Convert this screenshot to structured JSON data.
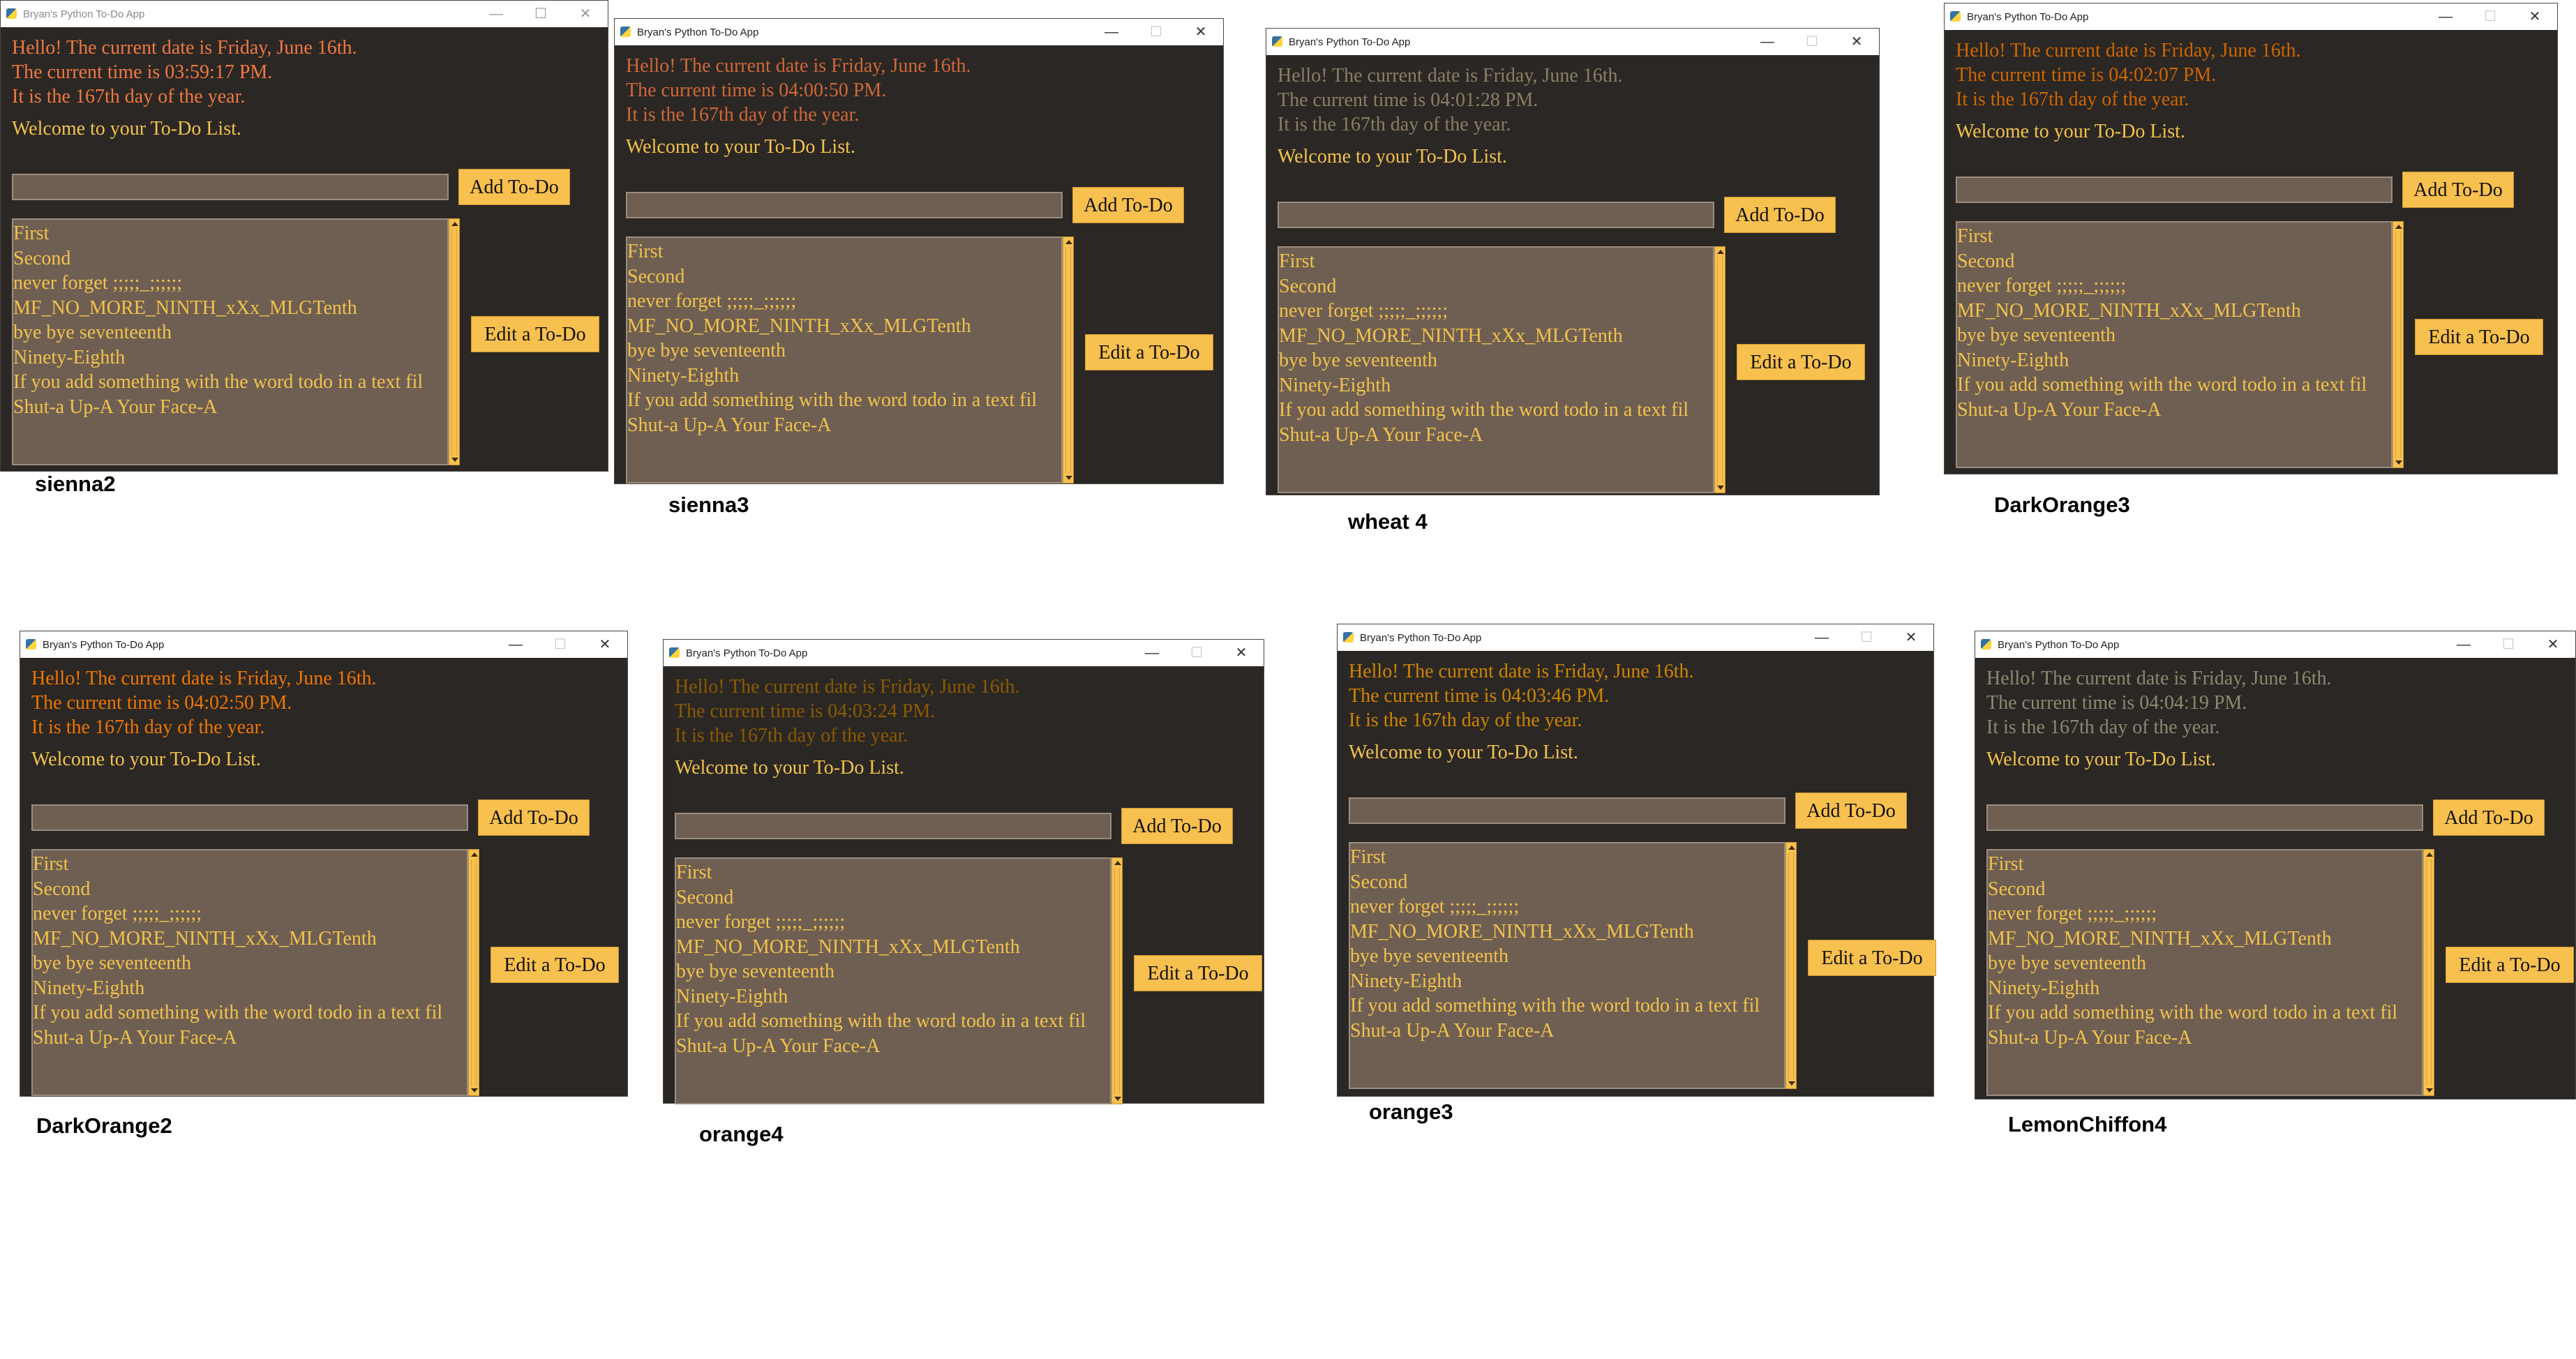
{
  "window": {
    "title": "Bryan's Python To-Do App",
    "minimize_glyph": "—",
    "maximize_glyph": "☐",
    "close_glyph": "✕"
  },
  "ui": {
    "welcome": "Welcome to your To-Do List.",
    "add_button": "Add To-Do",
    "edit_button": "Edit a To-Do",
    "entry_value": "",
    "info_day": "It is the 167th day of the year."
  },
  "todos": [
    "First",
    "Second",
    "never forget ;;;;;_;;;;;;",
    "MF_NO_MORE_NINTH_xXx_MLGTenth",
    "bye bye seventeenth",
    "Ninety-Eighth",
    "If you add something with the word todo in a text fil",
    "Shut-a Up-A Your Face-A"
  ],
  "panels": [
    {
      "caption": "sienna2",
      "line1": "Hello! The current date is Friday, June 16th.",
      "line2": "The current time is 03:59:17 PM.",
      "info_color": "#ee7942",
      "dim_title": true
    },
    {
      "caption": "sienna3",
      "line1": "Hello! The current date is Friday, June 16th.",
      "line2": "The current time is 04:00:50 PM.",
      "info_color": "#cd6839",
      "dim_title": false
    },
    {
      "caption": "wheat 4",
      "line1": "Hello! The current date is Friday, June 16th.",
      "line2": "The current time is 04:01:28 PM.",
      "info_color": "#8b7e66",
      "dim_title": false
    },
    {
      "caption": "DarkOrange3",
      "line1": "Hello! The current date is Friday, June 16th.",
      "line2": "The current time is 04:02:07 PM.",
      "info_color": "#cd6600",
      "dim_title": false
    },
    {
      "caption": "DarkOrange2",
      "line1": "Hello! The current date is Friday, June 16th.",
      "line2": "The current time is 04:02:50 PM.",
      "info_color": "#ee7600",
      "dim_title": false
    },
    {
      "caption": "orange4",
      "line1": "Hello! The current date is Friday, June 16th.",
      "line2": "The current time is 04:03:24 PM.",
      "info_color": "#8b5a00",
      "dim_title": false
    },
    {
      "caption": "orange3",
      "line1": "Hello! The current date is Friday, June 16th.",
      "line2": "The current time is 04:03:46 PM.",
      "info_color": "#cd8500",
      "dim_title": false
    },
    {
      "caption": "LemonChiffon4",
      "line1": "Hello! The current date is Friday, June 16th.",
      "line2": "The current time is 04:04:19 PM.",
      "info_color": "#8b8970",
      "dim_title": false
    }
  ]
}
